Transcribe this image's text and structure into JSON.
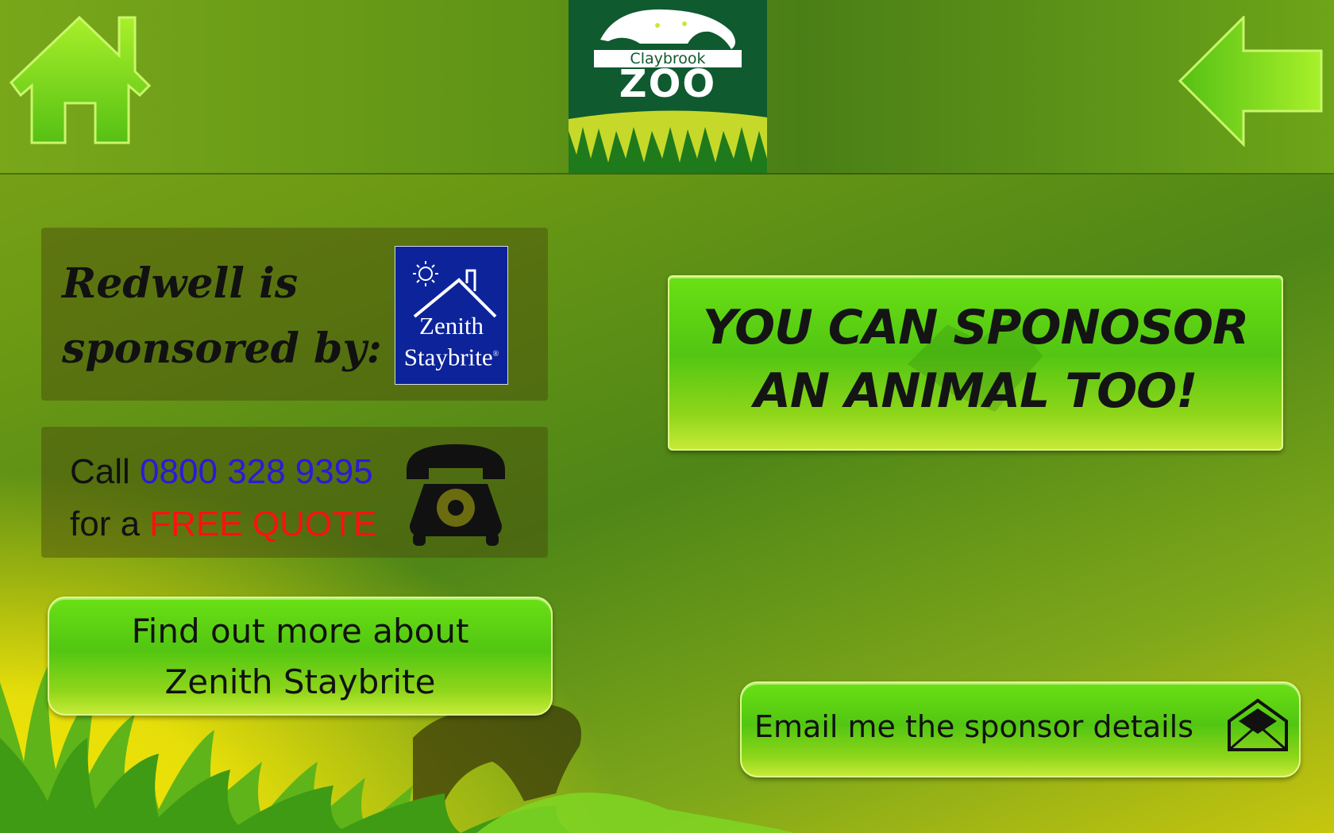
{
  "header": {
    "logo": {
      "brand": "Claybrook",
      "name": "ZOO"
    },
    "icons": {
      "home": "home-icon",
      "back": "back-arrow-icon"
    }
  },
  "sponsor": {
    "heading_line1": "Redwell is",
    "heading_line2": "sponsored by:",
    "logo": {
      "line1": "Zenith",
      "line2": "Staybrite",
      "mark": "®"
    }
  },
  "contact": {
    "call_prefix": "Call",
    "phone": "0800 328 9395",
    "for_prefix": "for a",
    "offer": "FREE QUOTE",
    "icon": "telephone-icon"
  },
  "buttons": {
    "find_more_line1": "Find out more about",
    "find_more_line2": "Zenith Staybrite",
    "sponsor_cta_line1": "YOU CAN SPONOSOR",
    "sponsor_cta_line2": "AN ANIMAL TOO!",
    "email": "Email me the sponsor details",
    "email_icon": "envelope-icon"
  },
  "colors": {
    "phone": "#2a1ad8",
    "offer": "#ff1010",
    "logo_bg": "#0f5a2f",
    "sponsor_logo_bg": "#0d239a"
  }
}
